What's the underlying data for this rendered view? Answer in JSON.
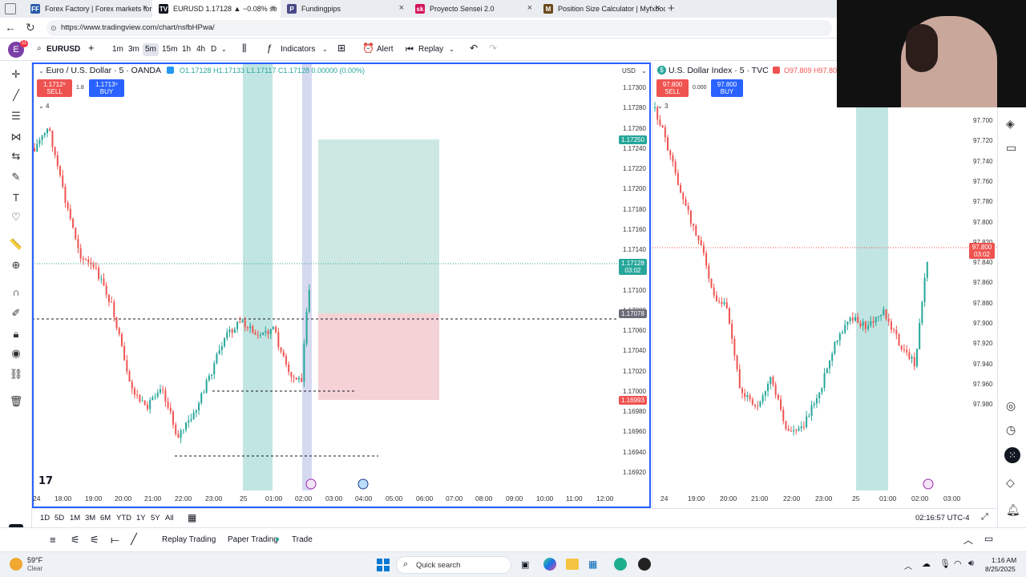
{
  "browser": {
    "tabs": [
      {
        "label": "Forex Factory | Forex markets for",
        "fav": "FF",
        "color": "#2a5caa"
      },
      {
        "label": "EURUSD 1.17128 ▲ −0.08% se",
        "fav": "TV",
        "color": "#131722"
      },
      {
        "label": "Fundingpips",
        "fav": "P",
        "color": "#4a4a8a"
      },
      {
        "label": "Proyecto Sensei 2.0",
        "fav": "sk",
        "color": "#d4145a"
      },
      {
        "label": "Position Size Calculator | Myfxboo",
        "fav": "M",
        "color": "#6b4a1c"
      }
    ],
    "new_tab": "+",
    "url": "https://www.tradingview.com/chart/nsfbHPwa/"
  },
  "toolbar": {
    "avatar_letter": "E",
    "avatar_badge": "11",
    "symbol": "EURUSD",
    "add": "+",
    "intervals": [
      "1m",
      "3m",
      "5m",
      "15m",
      "1h",
      "4h",
      "D"
    ],
    "selected_interval": "5m",
    "indicators": "Indicators",
    "alert": "Alert",
    "replay": "Replay"
  },
  "chart_left": {
    "title": "Euro / U.S. Dollar · 5 · OANDA",
    "ohlc": "O1.17128  H1.17133  L1.17117  C1.17128  0.00000 (0.00%)",
    "sell_price": "1.1712⁸",
    "sell_label": "SELL",
    "spread": "1.8",
    "buy_price": "1.1713⁶",
    "buy_label": "BUY",
    "indicator_count": "4",
    "currency": "USD",
    "price_labels": [
      "1.17300",
      "1.17280",
      "1.17260",
      "1.17240",
      "1.17220",
      "1.17200",
      "1.17180",
      "1.17160",
      "1.17140",
      "1.17120",
      "1.17100",
      "1.17080",
      "1.17060",
      "1.17040",
      "1.17020",
      "1.17000",
      "1.16980",
      "1.16960",
      "1.16940",
      "1.16920"
    ],
    "tag_target": "1.17250",
    "tag_current": "1.17128",
    "tag_countdown": "03:02",
    "tag_entry": "1.17078",
    "tag_stop": "1.16993",
    "time_labels": [
      "24",
      "18:00",
      "19:00",
      "20:00",
      "21:00",
      "22:00",
      "23:00",
      "25",
      "01:00",
      "02:00",
      "03:00",
      "04:00",
      "05:00",
      "06:00",
      "07:00",
      "08:00",
      "09:00",
      "10:00",
      "11:00",
      "12:00"
    ]
  },
  "chart_right": {
    "title": "U.S. Dollar Index · 5 · TVC",
    "ohlc": "O97.809  H97.809",
    "sell_price": "97.800",
    "sell_label": "SELL",
    "spread": "0.000",
    "buy_price": "97.800",
    "buy_label": "BUY",
    "indicator_count": "3",
    "price_labels": [
      "97.700",
      "97.720",
      "97.740",
      "97.760",
      "97.780",
      "97.800",
      "97.820",
      "97.840",
      "97.860",
      "97.880",
      "97.900",
      "97.920",
      "97.940",
      "97.960",
      "97.980"
    ],
    "tag_current": "97.800",
    "tag_countdown": "03:02",
    "time_labels": [
      "24",
      "19:00",
      "20:00",
      "21:00",
      "22:00",
      "23:00",
      "25",
      "01:00",
      "02:00",
      "03:00"
    ]
  },
  "rangebar": {
    "ranges": [
      "1D",
      "5D",
      "1M",
      "3M",
      "6M",
      "YTD",
      "1Y",
      "5Y",
      "All"
    ],
    "clock": "02:16:57 UTC-4"
  },
  "bottom": {
    "tabs": [
      "Replay Trading",
      "Paper Trading",
      "Trade"
    ]
  },
  "taskbar": {
    "weather_temp": "59°F",
    "weather_desc": "Clear",
    "search": "Quick search",
    "time": "1:16 AM",
    "date": "8/25/2025"
  },
  "colors": {
    "up": "#26a69a",
    "down": "#ef5350",
    "session": "#b2dfdb",
    "target_zone": "#c8e6df",
    "stop_zone": "#f4cdd2"
  }
}
